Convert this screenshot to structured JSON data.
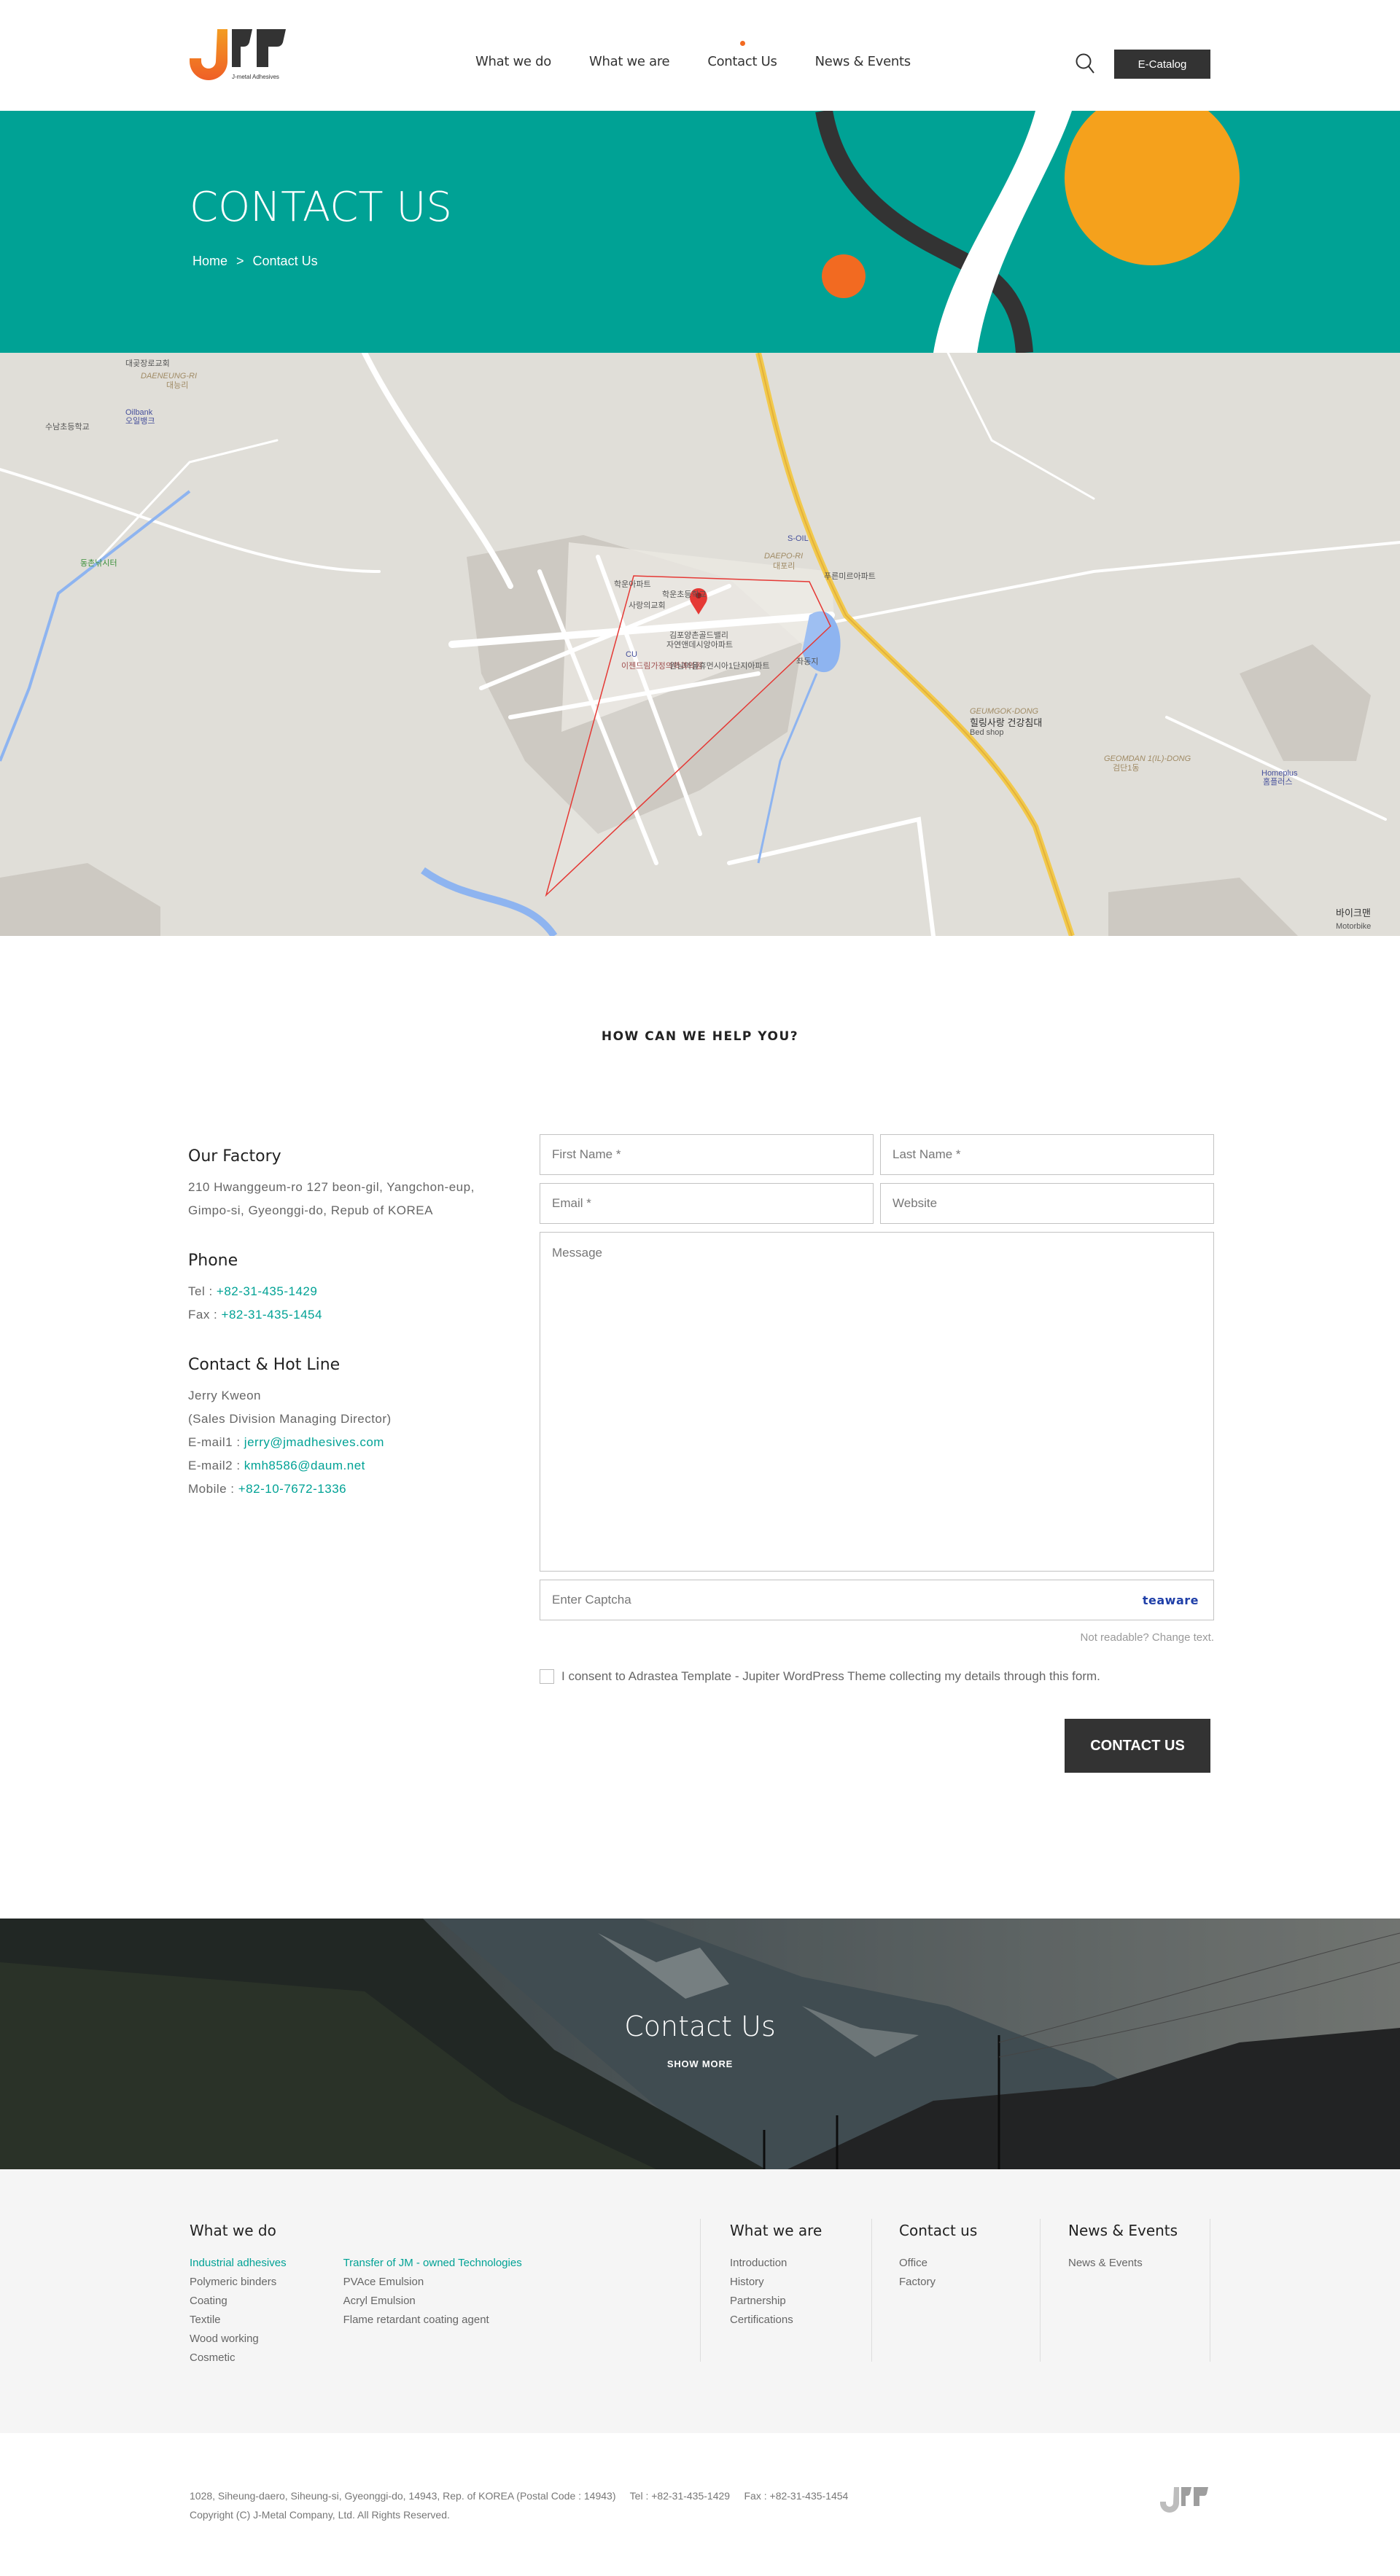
{
  "brand": {
    "logo_tagline": "J-metal Adhesives",
    "colors": {
      "teal": "#00a295",
      "orange": "#f26a21",
      "yellow": "#f5a11c",
      "dark": "#333333"
    }
  },
  "header": {
    "nav": [
      {
        "label": "What we do",
        "active": false
      },
      {
        "label": "What we are",
        "active": false
      },
      {
        "label": "Contact Us",
        "active": true
      },
      {
        "label": "News & Events",
        "active": false
      }
    ],
    "search_icon": "search-icon",
    "ecatalog_label": "E-Catalog"
  },
  "hero": {
    "title": "CONTACT US",
    "breadcrumb": {
      "home": "Home",
      "separator": ">",
      "current": "Contact Us"
    }
  },
  "map": {
    "labels": [
      "DAENEUNG-RI",
      "대능리",
      "Oilbank",
      "오일뱅크",
      "수남초등학교",
      "대곶장로교회",
      "동촌낚시터",
      "S-OIL",
      "DAEPO-RI",
      "대포리",
      "학운아파트",
      "학운초등학교",
      "사랑의교회",
      "김포양촌골드밸리",
      "자연앤데시앙아파트",
      "CU",
      "이젠드림가정의학과의원",
      "원님마을휴먼시아1단지아파트",
      "좌동지",
      "푸른미르아파트",
      "GEUMGOK-DONG",
      "힐링사랑 건강침대",
      "Bed shop",
      "GEOMDAN 1(IL)-DONG",
      "검단1동",
      "Homeplus",
      "홈플러스",
      "바이크맨",
      "Motorbike"
    ]
  },
  "help": {
    "title": "HOW CAN WE HELP YOU?"
  },
  "info": {
    "factory": {
      "title": "Our Factory",
      "line1": "210 Hwanggeum-ro 127 beon-gil, Yangchon-eup,",
      "line2": "Gimpo-si, Gyeonggi-do, Repub of KOREA"
    },
    "phone": {
      "title": "Phone",
      "tel_label": "Tel : ",
      "tel": "+82-31-435-1429",
      "fax_label": "Fax : ",
      "fax": "+82-31-435-1454"
    },
    "hotline": {
      "title": "Contact & Hot Line",
      "name": "Jerry Kweon",
      "role": "(Sales Division Managing Director)",
      "email1_label": "E-mail1 : ",
      "email1": "jerry@jmadhesives.com",
      "email2_label": "E-mail2 : ",
      "email2": "kmh8586@daum.net",
      "mobile_label": "Mobile : ",
      "mobile": "+82-10-7672-1336"
    }
  },
  "form": {
    "first_name_placeholder": "First Name *",
    "last_name_placeholder": "Last Name *",
    "email_placeholder": "Email *",
    "website_placeholder": "Website",
    "message_placeholder": "Message",
    "captcha_placeholder": "Enter Captcha",
    "captcha_image_text": "teaware",
    "not_readable": "Not readable? Change text.",
    "consent": "I consent to Adrastea Template - Jupiter WordPress Theme collecting my details through this form.",
    "consent_checked": false,
    "submit_label": "CONTACT US"
  },
  "banner": {
    "title": "Contact Us",
    "more": "SHOW MORE"
  },
  "footer": {
    "what_we_do": {
      "title": "What we do",
      "col1_head": "Industrial adhesives",
      "col1": [
        "Polymeric binders",
        "Coating",
        "Textile",
        "Wood working",
        "Cosmetic"
      ],
      "col2_head": "Transfer of JM - owned Technologies",
      "col2": [
        "PVAce Emulsion",
        "Acryl Emulsion",
        "Flame retardant coating agent"
      ]
    },
    "what_we_are": {
      "title": "What we are",
      "items": [
        "Introduction",
        "History",
        "Partnership",
        "Certifications"
      ]
    },
    "contact_us": {
      "title": "Contact us",
      "items": [
        "Office",
        "Factory"
      ]
    },
    "news": {
      "title": "News & Events",
      "items": [
        "News & Events"
      ]
    },
    "address": "1028, Siheung-daero, Siheung-si, Gyeonggi-do, 14943, Rep. of KOREA (Postal Code : 14943)     Tel : +82-31-435-1429     Fax : +82-31-435-1454",
    "copyright": "Copyright (C) J-Metal Company, Ltd. All Rights Reserved."
  }
}
